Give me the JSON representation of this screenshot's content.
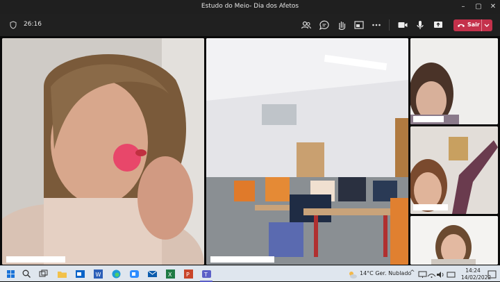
{
  "window": {
    "title": "Estudo do Meio- Dia dos Afetos"
  },
  "meeting": {
    "elapsed": "26:16",
    "leave_label": "Sair"
  },
  "taskbar": {
    "weather_temp": "14°C",
    "weather_text": "Ger. Nublado",
    "time": "14:24",
    "date": "14/02/2022"
  },
  "colors": {
    "leave": "#c4314b",
    "titlebar": "#1f1f1f",
    "toolbar": "#202020",
    "taskbar": "#dfe6ee"
  }
}
